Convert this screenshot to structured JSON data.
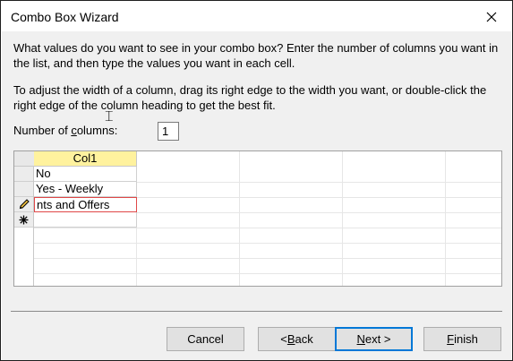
{
  "window": {
    "title": "Combo Box Wizard"
  },
  "instructions": {
    "line1": "What values do you want to see in your combo box? Enter the number of columns you want in the list, and then type the values you want in each cell.",
    "line2": "To adjust the width of a column, drag its right edge to the width you want, or double-click the right edge of the column heading to get the best fit."
  },
  "columns_field": {
    "label": "Number of columns:",
    "value": "1"
  },
  "grid": {
    "column_header": "Col1",
    "rows": [
      "No",
      "Yes - Weekly",
      "nts and Offers",
      ""
    ],
    "row_markers": [
      "",
      "",
      "pencil-icon",
      "new-record-asterisk-icon"
    ]
  },
  "buttons": {
    "cancel": "Cancel",
    "back": "< Back",
    "next": "Next >",
    "finish": "Finish"
  }
}
